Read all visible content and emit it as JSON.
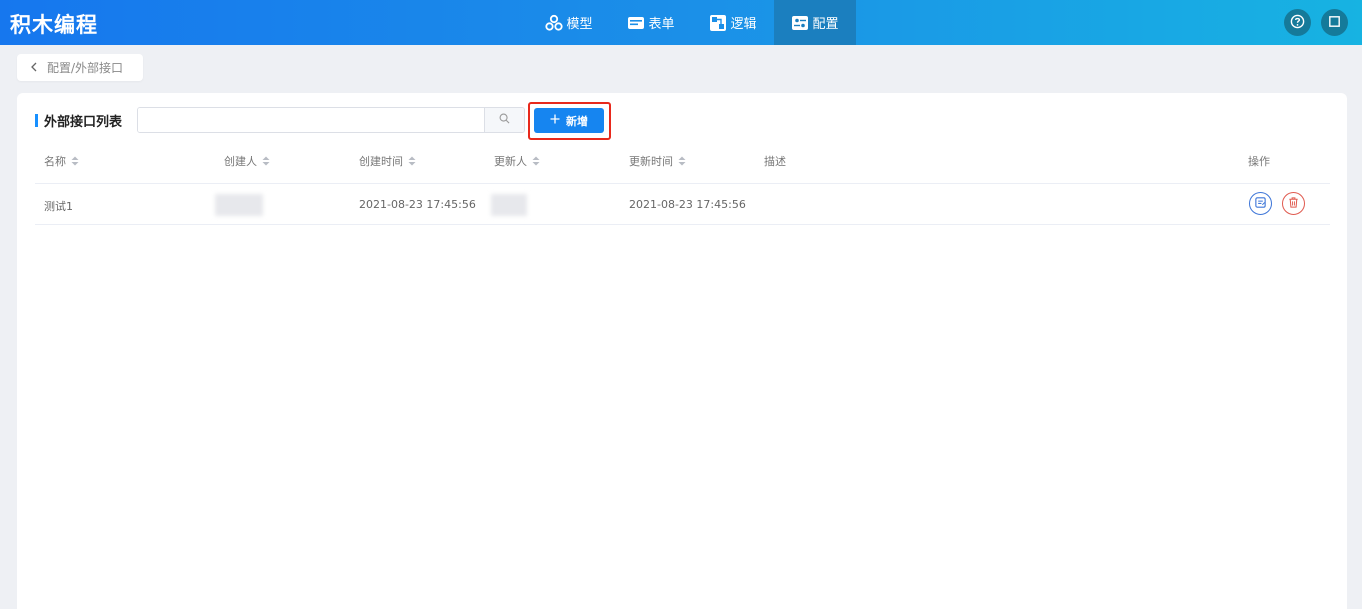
{
  "app": {
    "title": "积木编程"
  },
  "nav": {
    "items": [
      {
        "label": "模型",
        "icon": "model-icon"
      },
      {
        "label": "表单",
        "icon": "form-icon"
      },
      {
        "label": "逻辑",
        "icon": "logic-icon"
      },
      {
        "label": "配置",
        "icon": "config-icon",
        "active": true
      }
    ]
  },
  "header_icons": [
    "help-icon",
    "fullscreen-icon"
  ],
  "breadcrumb": {
    "path": "配置/外部接口"
  },
  "list": {
    "title": "外部接口列表",
    "search_placeholder": "",
    "add_label": "新增"
  },
  "table": {
    "columns": [
      "名称",
      "创建人",
      "创建时间",
      "更新人",
      "更新时间",
      "描述",
      "操作"
    ],
    "rows": [
      {
        "name": "测试1",
        "creator": "",
        "created_at": "2021-08-23 17:45:56",
        "updater": "",
        "updated_at": "2021-08-23 17:45:56",
        "description": ""
      }
    ]
  },
  "colors": {
    "primary": "#1685f0",
    "highlight_border": "#e8291c",
    "nav_active": "#1b7fbf",
    "edit": "#3e76d8",
    "delete": "#e05a4f"
  }
}
